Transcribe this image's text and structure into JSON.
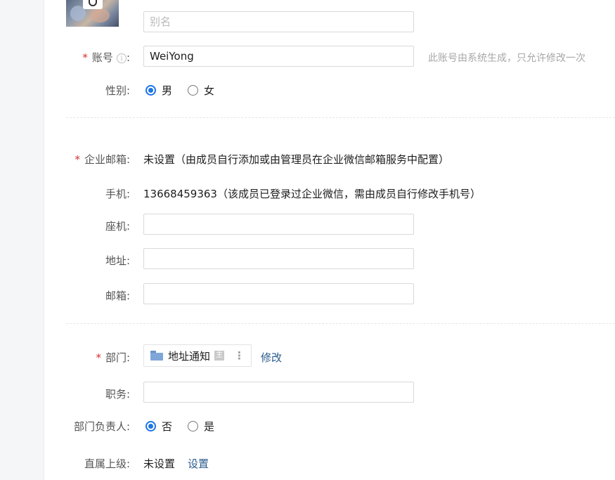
{
  "alias": {
    "placeholder": "别名",
    "value": ""
  },
  "account": {
    "label": "账号",
    "info_icon_glyph": "i",
    "value": "WeiYong",
    "hint": "此账号由系统生成，只允许修改一次"
  },
  "gender": {
    "label": "性别:",
    "options": [
      "男",
      "女"
    ],
    "selected": "男"
  },
  "email_corp": {
    "label": "企业邮箱:",
    "value": "未设置（由成员自行添加或由管理员在企业微信邮箱服务中配置）"
  },
  "mobile": {
    "label": "手机:",
    "value": "13668459363（该成员已登录过企业微信，需由成员自行修改手机号）"
  },
  "landline": {
    "label": "座机:",
    "value": ""
  },
  "address": {
    "label": "地址:",
    "value": ""
  },
  "mailbox": {
    "label": "邮箱:",
    "value": ""
  },
  "department": {
    "label": "部门:",
    "chip_name": "地址通知",
    "main_badge": "主",
    "modify_link": "修改"
  },
  "position": {
    "label": "职务:",
    "value": ""
  },
  "dept_leader": {
    "label": "部门负责人:",
    "options": [
      "否",
      "是"
    ],
    "selected": "否"
  },
  "direct_superior": {
    "label": "直属上级:",
    "value": "未设置",
    "set_link": "设置"
  },
  "required_mark": "*",
  "colors": {
    "accent": "#1e76e6",
    "link": "#2a5b8c",
    "required": "#d43030",
    "hint": "#a8a8a8"
  }
}
